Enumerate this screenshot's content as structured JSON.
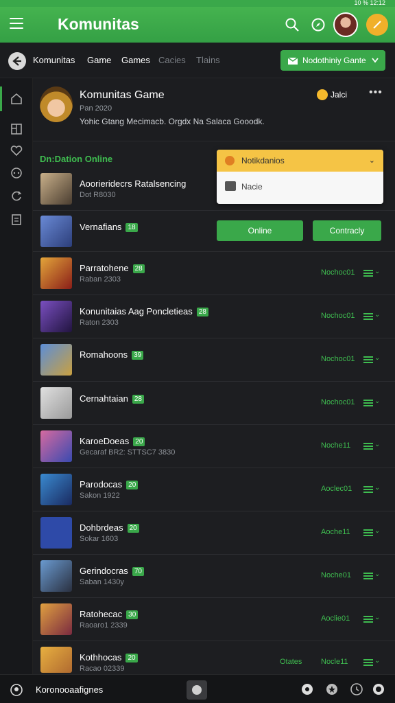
{
  "status": {
    "text": "10 %  12:12"
  },
  "appbar": {
    "title": "Komunitas"
  },
  "nav": {
    "tabs": [
      "Komunitas",
      "Game",
      "Games",
      "Cacies",
      "Tlains"
    ],
    "notif_button": "Nodothiniy Gante"
  },
  "header": {
    "title": "Komunitas Game",
    "subtitle": "Pan 2020",
    "description": "Yohic Gtang Mecimacb. Orgdx Na Salaca Gooodk.",
    "badge": "Jalci"
  },
  "section": {
    "title": "Dn:Dation Online"
  },
  "dropdown": {
    "header": "Notikdanios",
    "item": "Nacie"
  },
  "buttons": {
    "online": "Online",
    "contact": "Contracly"
  },
  "rows": [
    {
      "name": "Aoorieridecrs Ratalsencing",
      "tag": "",
      "meta": "Dot R8030",
      "status": ""
    },
    {
      "name": "Vernafians",
      "tag": "18",
      "meta": "",
      "status": ""
    },
    {
      "name": "Parratohene",
      "tag": "28",
      "meta": "Raban 2303",
      "status": "Nochoc01"
    },
    {
      "name": "Konunitaias Aag Poncletieas",
      "tag": "28",
      "meta": "Raton 2303",
      "status": "Nochoc01"
    },
    {
      "name": "Romahoons",
      "tag": "39",
      "meta": "",
      "status": "Nochoc01"
    },
    {
      "name": "Cernahtaian",
      "tag": "28",
      "meta": "",
      "status": "Nochoc01"
    },
    {
      "name": "KaroeDoeas",
      "tag": "20",
      "meta": "Gecaraf BR2: STTSC7 3830",
      "status": "Noche11"
    },
    {
      "name": "Parodocas",
      "tag": "20",
      "meta": "Sakon 1922",
      "status": "Aoclec01"
    },
    {
      "name": "Dohbrdeas",
      "tag": "20",
      "meta": "Sokar 1603",
      "status": "Aoche11"
    },
    {
      "name": "Gerindocras",
      "tag": "70",
      "meta": "Saban 1430y",
      "status": "Noche01"
    },
    {
      "name": "Ratohecac",
      "tag": "30",
      "meta": "Raoaro1 2339",
      "status": "Aoclie01"
    },
    {
      "name": "Kothhocas",
      "tag": "20",
      "meta": "Racao 02339",
      "status": "Nocle11",
      "extra": "Otates"
    }
  ],
  "bottom": {
    "label": "Koronooaafignes"
  },
  "colors": {
    "accent": "#3aa84a",
    "background": "#141517",
    "warning": "#f5c445"
  }
}
